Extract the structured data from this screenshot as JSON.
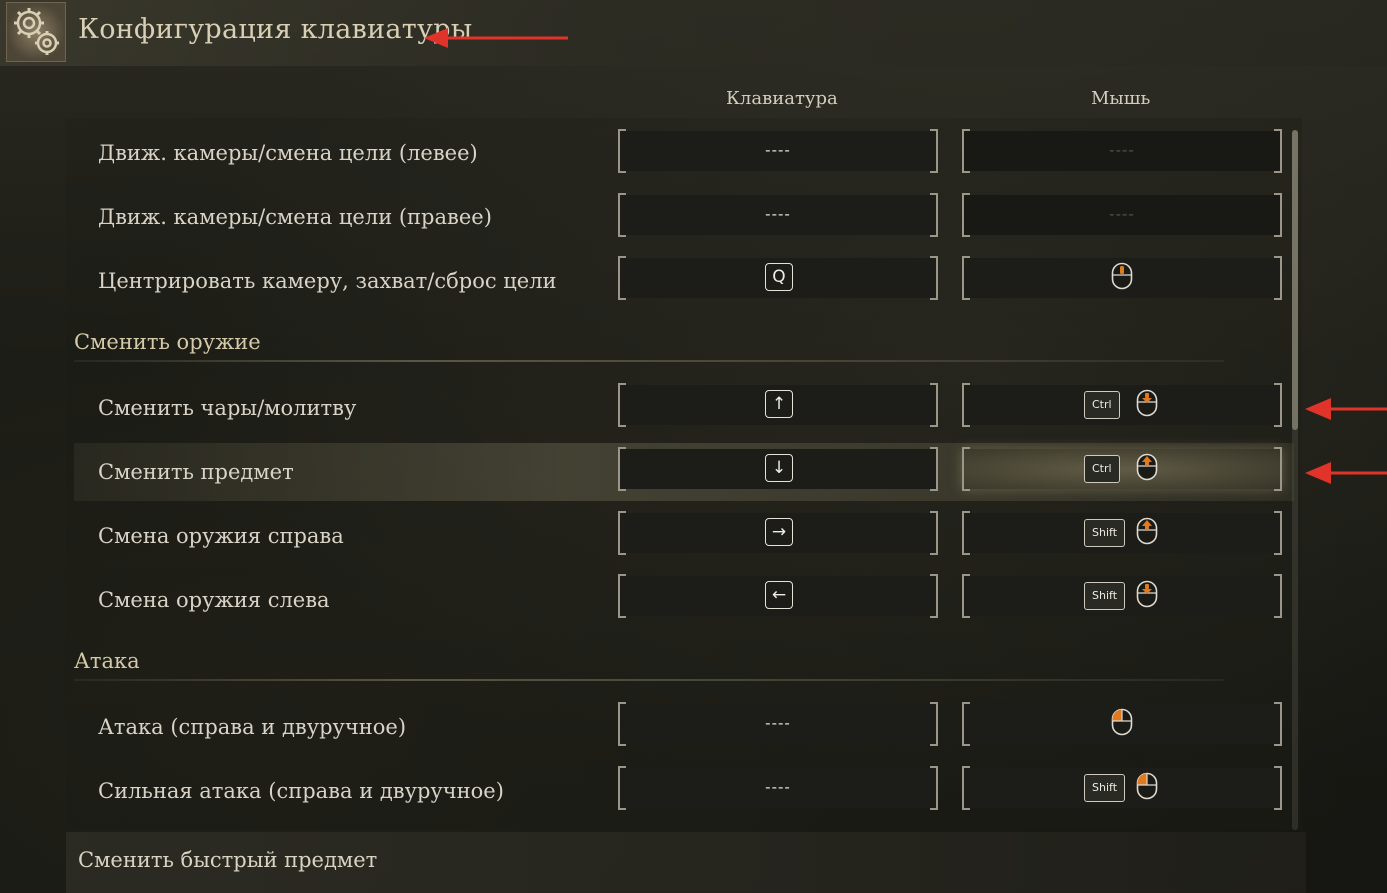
{
  "header": {
    "title": "Конфигурация клавиатуры"
  },
  "columns": {
    "keyboard": "Клавиатура",
    "mouse": "Мышь"
  },
  "rows": [
    {
      "label": "Движ. камеры/смена цели (левее)",
      "kb": "----",
      "ms": "----"
    },
    {
      "label": "Движ. камеры/смена цели (правее)",
      "kb": "----",
      "ms": "----"
    },
    {
      "label": "Центрировать камеру, захват/сброс цели",
      "kb": "Q",
      "ms": "mouse-middle-click-icon"
    },
    {
      "label": "Сменить чары/молитву",
      "kb": "↑",
      "ms_mod": "Ctrl",
      "ms": "mouse-wheel-down-icon"
    },
    {
      "label": "Сменить предмет",
      "kb": "↓",
      "ms_mod": "Ctrl",
      "ms": "mouse-wheel-up-icon"
    },
    {
      "label": "Смена оружия справа",
      "kb": "→",
      "ms_mod": "Shift",
      "ms": "mouse-wheel-up-icon"
    },
    {
      "label": "Смена оружия слева",
      "kb": "←",
      "ms_mod": "Shift",
      "ms": "mouse-wheel-down-icon"
    },
    {
      "label": "Атака (справа и двуручное)",
      "kb": "----",
      "ms": "mouse-left-click-icon"
    },
    {
      "label": "Сильная атака (справа и двуручное)",
      "kb": "----",
      "ms_mod": "Shift",
      "ms": "mouse-left-click-icon"
    }
  ],
  "sections": {
    "weapons": "Сменить оружие",
    "attack": "Атака"
  },
  "bottom": {
    "label": "Сменить быстрый предмет"
  },
  "colors": {
    "accent": "#e07a1e",
    "annotation": "#e0342a"
  }
}
